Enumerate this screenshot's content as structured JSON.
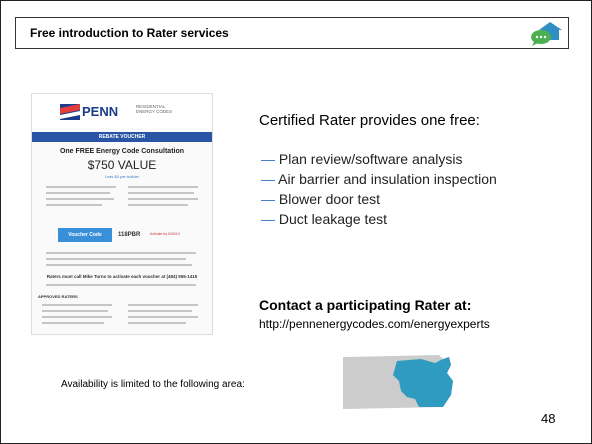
{
  "slide": {
    "title": "Free introduction to Rater services",
    "heading": "Certified Rater provides one free:",
    "bullets": [
      "Plan review/software analysis",
      "Air barrier and insulation inspection",
      "Blower door test",
      "Duct leakage test"
    ],
    "contact_heading": "Contact a participating Rater at:",
    "contact_url": "http://pennenergycodes.com/energyexperts",
    "availability_text": "Availability is limited to the following area:",
    "page_number": "48"
  },
  "voucher": {
    "brand": "PENN",
    "brand_sub": "RESIDENTIAL ENERGY CODES",
    "band": "REBATE VOUCHER",
    "offer": "One FREE Energy Code Consultation",
    "value": "$750 VALUE",
    "cost_note": "Less $0 per builder",
    "button": "Voucher Code",
    "code": "118PBR",
    "code_note": "Activate by 6/30/19",
    "bold_note": "Raters must call Mike Turns to activate each voucher at (484) 555-1415",
    "section_label": "APPROVED RATERS"
  },
  "colors": {
    "accent": "#3a78c8",
    "title_border": "#333333",
    "map_fill": "#2f9bc1",
    "map_base": "#cccccc",
    "voucher_band": "#2a55a6",
    "voucher_button": "#3a8fd9",
    "brand_text": "#1b3c8a"
  },
  "icons": {
    "logo": "house-chat-logo-icon",
    "dash": "dash-icon",
    "flag": "flag-icon",
    "map": "pennsylvania-map-icon"
  }
}
